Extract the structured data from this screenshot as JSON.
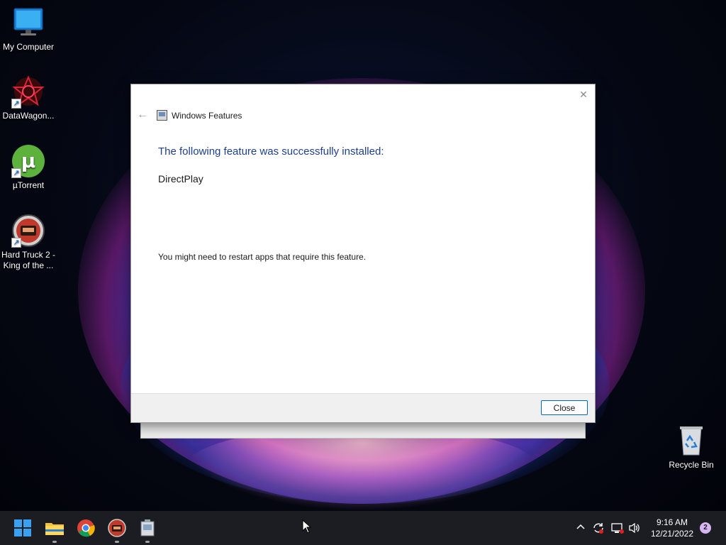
{
  "desktop": {
    "icons": [
      {
        "label": "My Computer",
        "icon": "monitor-icon"
      },
      {
        "label": "DataWagon...",
        "icon": "datawagon-icon"
      },
      {
        "label": "µTorrent",
        "icon": "utorrent-icon"
      },
      {
        "label": "Hard Truck 2 -\nKing of the ...",
        "icon": "truck-game-icon"
      },
      {
        "label": "Recycle Bin",
        "icon": "recycle-bin-icon"
      }
    ]
  },
  "dialog": {
    "title": "Windows Features",
    "headline": "The following feature was successfully installed:",
    "feature": "DirectPlay",
    "note": "You might need to restart apps that require this feature.",
    "close_button": "Close",
    "close_glyph": "✕",
    "back_glyph": "←"
  },
  "taskbar": {
    "apps": [
      "start-icon",
      "file-explorer-icon",
      "chrome-icon",
      "truck-game-icon",
      "setup-icon"
    ],
    "time": "9:16 AM",
    "date": "12/21/2022",
    "notification_count": "2",
    "tray_icons": [
      "chevron-up-icon",
      "sync-icon",
      "network-icon",
      "volume-icon"
    ]
  },
  "colors": {
    "headline": "#1f3f8a",
    "accent": "#0067c0",
    "taskbar": "#1c1d22"
  }
}
